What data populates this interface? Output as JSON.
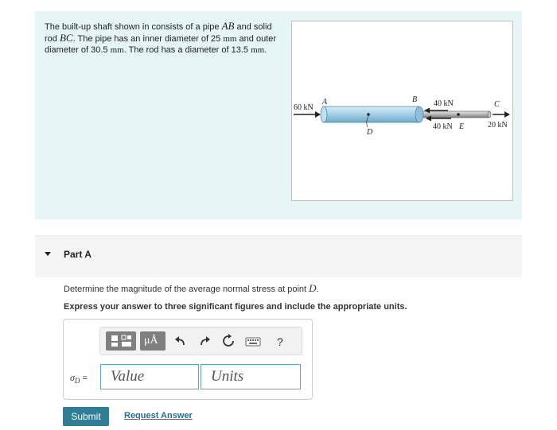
{
  "problem": {
    "text_1": "The built-up shaft shown in consists of a pipe ",
    "pipe_label": "AB",
    "text_2": " and solid rod ",
    "rod_label": "BC",
    "text_3": ". The pipe has an inner diameter of 25 ",
    "unit_mm": "mm",
    "text_4": " and outer diameter of 30.5 ",
    "text_5": ". The rod has a diameter of 13.5 ",
    "text_6": "."
  },
  "figure": {
    "load_left": "60 kN",
    "load_b": "40 kN",
    "load_e": "40 kN",
    "load_right": "20 kN",
    "point_a": "A",
    "point_b": "B",
    "point_c": "C",
    "point_d": "D",
    "point_e": "E"
  },
  "part_a": {
    "title": "Part A",
    "question_pre": "Determine the magnitude of the average normal stress at point ",
    "question_point": "D",
    "question_post": ".",
    "instruction": "Express your answer to three significant figures and include the appropriate units."
  },
  "toolbar": {
    "units_btn": "μÅ",
    "help": "?"
  },
  "answer": {
    "sigma_symbol": "σ",
    "sigma_sub": "D",
    "equals": " =",
    "value_placeholder": "Value",
    "units_placeholder": "Units"
  },
  "actions": {
    "submit": "Submit",
    "request_answer": "Request Answer"
  },
  "colors": {
    "panel_bg": "#e6f5f5",
    "accent": "#2f7d95",
    "link": "#1f6f9e",
    "field_border": "#5aa8b8",
    "pipe": "#a8d4ea"
  }
}
